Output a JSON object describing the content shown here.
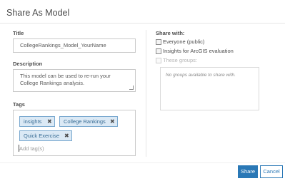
{
  "dialog": {
    "title": "Share As Model"
  },
  "form": {
    "title_label": "Title",
    "title_value": "CollegeRankings_Model_YourName",
    "description_label": "Description",
    "description_value": "This model can be used to re-run your College Rankings analysis.",
    "tags_label": "Tags",
    "tags": [
      "insights",
      "College Rankings",
      "Quick Exercise"
    ],
    "tags_placeholder": "Add tag(s)"
  },
  "share": {
    "label": "Share with:",
    "options": [
      {
        "label": "Everyone (public)",
        "checked": false,
        "disabled": false
      },
      {
        "label": "Insights for ArcGIS evaluation",
        "checked": false,
        "disabled": false
      },
      {
        "label": "These groups:",
        "checked": false,
        "disabled": true
      }
    ],
    "groups_empty": "No groups available to share with."
  },
  "footer": {
    "share_button": "Share",
    "cancel_button": "Cancel"
  },
  "colors": {
    "accent": "#2a78b6",
    "tag_background": "#dbe9f5",
    "tag_border": "#7aa9cf"
  },
  "icons": {
    "tag_remove": "close-icon"
  }
}
